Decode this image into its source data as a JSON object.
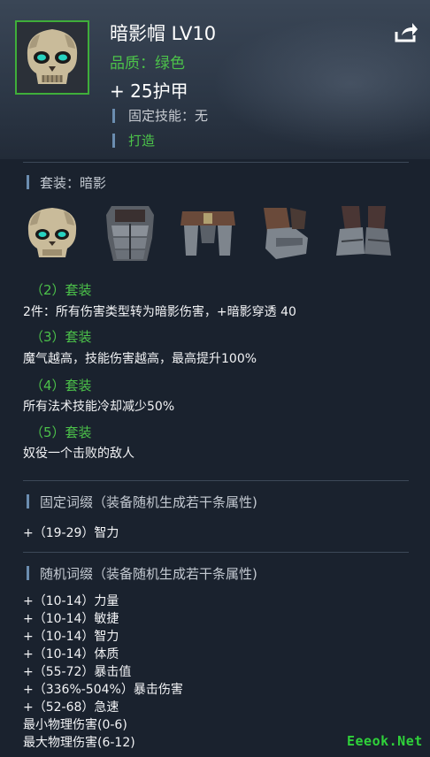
{
  "item": {
    "name": "暗影帽 LV10",
    "quality": "品质：绿色",
    "armor": "+ 25护甲",
    "fixed_skill": "固定技能：无",
    "forge": "打造"
  },
  "set": {
    "title": "套装：暗影",
    "pieces": [
      "skull-helm-icon",
      "chest-armor-icon",
      "belt-armor-icon",
      "gauntlet-icon",
      "boots-icon"
    ],
    "bonuses": [
      {
        "head": "（2）套装",
        "text": "2件：所有伤害类型转为暗影伤害，+暗影穿透 40"
      },
      {
        "head": "（3）套装",
        "text": "魔气越高，技能伤害越高，最高提升100%"
      },
      {
        "head": "（4）套装",
        "text": "所有法术技能冷却减少50%"
      },
      {
        "head": "（5）套装",
        "text": "奴役一个击败的敌人"
      }
    ]
  },
  "fixed_affix": {
    "title": "固定词缀（装备随机生成若干条属性)",
    "items": [
      "+（19-29）智力"
    ]
  },
  "random_affix": {
    "title": "随机词缀（装备随机生成若干条属性)",
    "items": [
      "+（10-14）力量",
      "+（10-14）敏捷",
      "+（10-14）智力",
      "+（10-14）体质",
      "+（55-72）暴击值",
      "+（336%-504%）暴击伤害",
      "+（52-68）急速",
      "最小物理伤害(0-6)",
      "最大物理伤害(6-12)"
    ]
  },
  "watermark": "Eeeok.Net",
  "colors": {
    "quality_green": "#4cc24a",
    "background": "#1a222e",
    "accent_bar": "#6b8db0"
  }
}
